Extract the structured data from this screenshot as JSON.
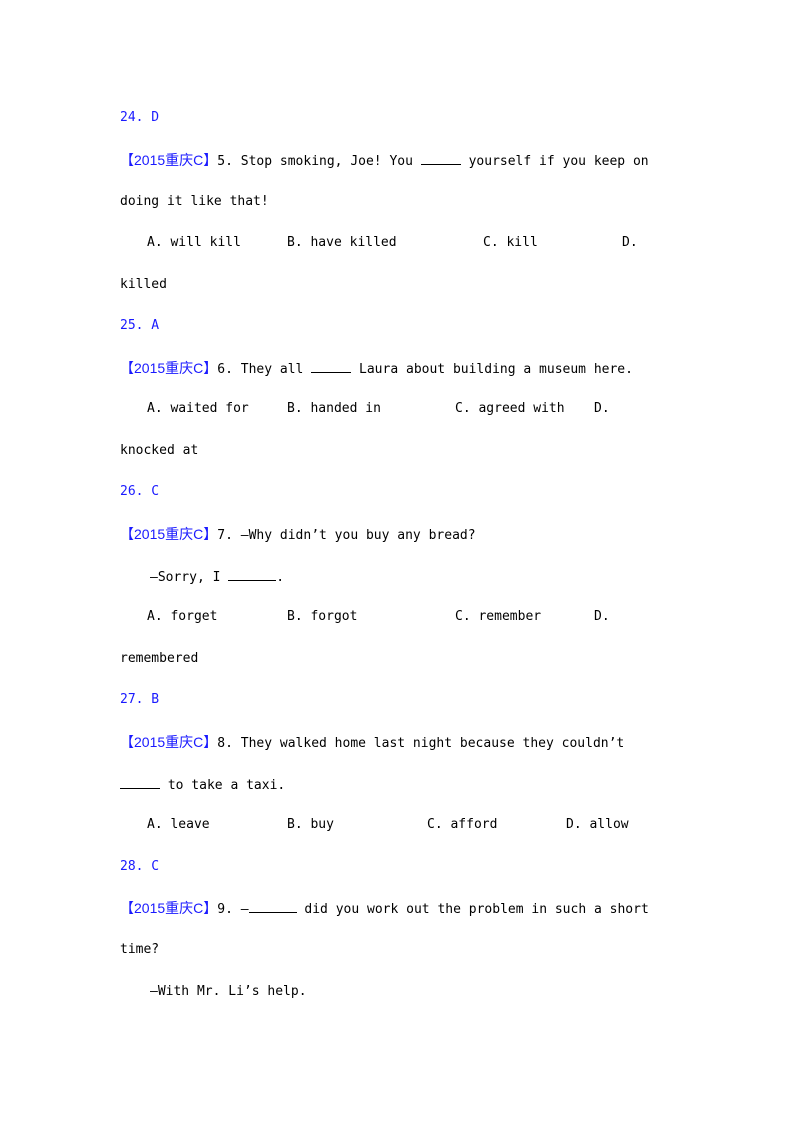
{
  "answers": [
    "24. D",
    "25. A",
    "26. C",
    "27. B",
    "28. C"
  ],
  "source_tag": "【2015重庆C】",
  "questions": [
    {
      "num": "5.",
      "line1_before": "Stop smoking, Joe! You",
      "line1_after": "yourself if you keep on",
      "line2": "doing it like that!",
      "options": [
        "A. will kill",
        "B. have killed",
        "C. kill",
        "D."
      ],
      "option_wrap": "killed"
    },
    {
      "num": "6.",
      "line1_before": "They all",
      "line1_after": "Laura about building a museum here.",
      "options": [
        "A. waited for",
        "B. handed in",
        "C. agreed with",
        "D."
      ],
      "option_wrap": "knocked at"
    },
    {
      "num": "7.",
      "line1": "—Why didn’t you buy any bread?",
      "line2_before": "—Sorry, I",
      "line2_after": ".",
      "options": [
        "A. forget",
        "B. forgot",
        "C. remember",
        "D."
      ],
      "option_wrap": "remembered"
    },
    {
      "num": "8.",
      "line1": "They walked home last night because they couldn’t",
      "line2_after": "to take a taxi.",
      "options": [
        "A. leave",
        "B. buy",
        "C. afford",
        "D. allow"
      ]
    },
    {
      "num": "9.",
      "line1_before": "—",
      "line1_after": "did you work out the problem in such a short",
      "line2": "time?",
      "line3": "—With Mr. Li’s help."
    }
  ]
}
